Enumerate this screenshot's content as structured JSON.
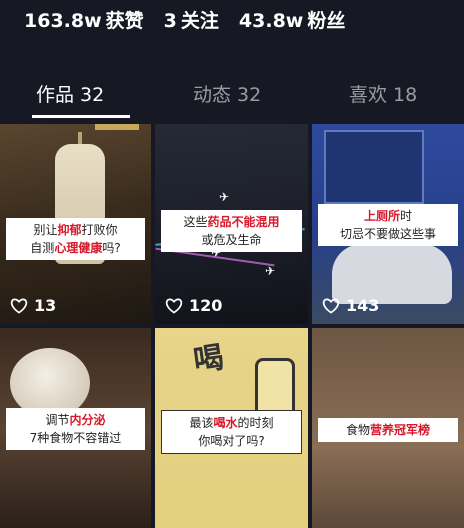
{
  "stats": [
    {
      "num": "163.8w",
      "label": "获赞"
    },
    {
      "num": "3",
      "label": "关注"
    },
    {
      "num": "43.8w",
      "label": "粉丝"
    }
  ],
  "tabs": [
    {
      "label": "作品 32"
    },
    {
      "label": "动态 32"
    },
    {
      "label": "喜欢 18"
    }
  ],
  "posts": [
    {
      "line1_pre": "别让",
      "line1_hl": "抑郁",
      "line1_post": "打败你",
      "line2_pre": "自测",
      "line2_hl": "心理健康",
      "line2_post": "吗?",
      "likes": "13"
    },
    {
      "line1_pre": "这些",
      "line1_hl": "药品不能混用",
      "line1_post": "",
      "line2_pre": "或危及生命",
      "line2_hl": "",
      "line2_post": "",
      "likes": "120"
    },
    {
      "line1_pre": "",
      "line1_hl": "上厕所",
      "line1_post": "时",
      "line2_pre": "切忌不要做这些事",
      "line2_hl": "",
      "line2_post": "",
      "likes": "143"
    },
    {
      "line1_pre": "调节",
      "line1_hl": "内分泌",
      "line1_post": "",
      "line2_pre": "7种食物不容错过",
      "line2_hl": "",
      "line2_post": "",
      "likes": ""
    },
    {
      "line1_pre": "最该",
      "line1_hl": "喝水",
      "line1_post": "的时刻",
      "line2_pre": "你喝对了吗?",
      "line2_hl": "",
      "line2_post": "",
      "likes": ""
    },
    {
      "line1_pre": "食物",
      "line1_hl": "营养冠军榜",
      "line1_post": "",
      "line2_pre": "",
      "line2_hl": "",
      "line2_post": "",
      "likes": ""
    }
  ],
  "bg_text": {
    "drink": "喝"
  },
  "colors": {
    "background": "#161823",
    "highlight": "#d8182b",
    "tab_inactive": "#9b9ca2"
  }
}
